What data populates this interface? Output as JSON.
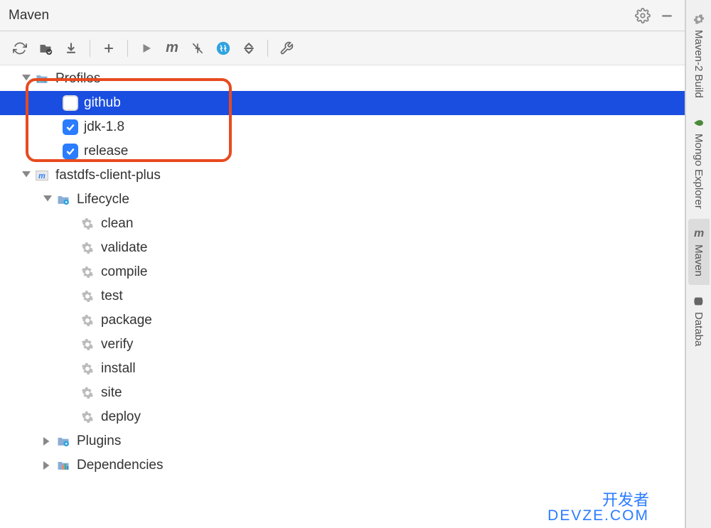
{
  "panel": {
    "title": "Maven"
  },
  "tree": {
    "profiles": {
      "label": "Profiles",
      "items": [
        {
          "label": "github",
          "checked": false,
          "selected": true
        },
        {
          "label": "jdk-1.8",
          "checked": true,
          "selected": false
        },
        {
          "label": "release",
          "checked": true,
          "selected": false
        }
      ]
    },
    "project": {
      "label": "fastdfs-client-plus",
      "lifecycle": {
        "label": "Lifecycle",
        "goals": [
          "clean",
          "validate",
          "compile",
          "test",
          "package",
          "verify",
          "install",
          "site",
          "deploy"
        ]
      },
      "plugins": {
        "label": "Plugins"
      },
      "dependencies": {
        "label": "Dependencies"
      }
    }
  },
  "sidebar": {
    "tabs": [
      {
        "label": "Maven-2 Build",
        "active": false
      },
      {
        "label": "Mongo Explorer",
        "active": false
      },
      {
        "label": "Maven",
        "active": true
      },
      {
        "label": "Databa",
        "active": false
      }
    ]
  },
  "watermark": {
    "line1": "开发者",
    "line2": "DevZe.CoM"
  }
}
